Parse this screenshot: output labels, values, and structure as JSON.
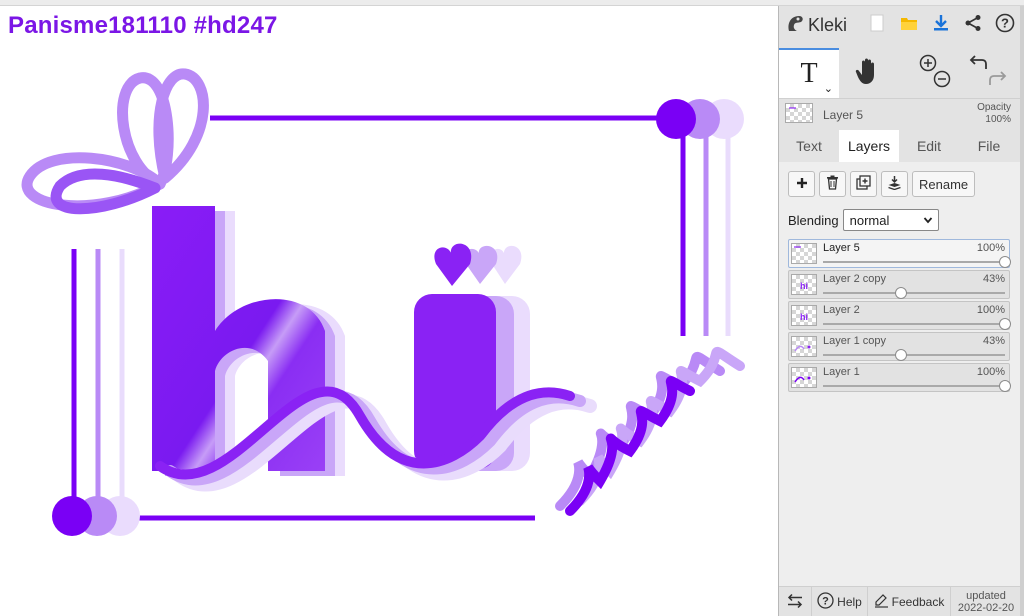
{
  "canvas": {
    "title": "Panisme181110 #hd247",
    "accent": "#7a00f5"
  },
  "header": {
    "app_name": "Kleki",
    "icons": [
      "kleki-logo-icon",
      "new-file-icon",
      "open-folder-icon",
      "download-icon",
      "share-icon",
      "help-icon"
    ]
  },
  "tools": {
    "items": [
      {
        "name": "text-tool",
        "label": "T",
        "active": true
      },
      {
        "name": "hand-tool",
        "active": false
      },
      {
        "name": "zoom-tool",
        "active": false
      },
      {
        "name": "undo-redo",
        "active": false
      }
    ]
  },
  "current_layer": {
    "name": "Layer 5",
    "opacity_label": "Opacity",
    "opacity_value": "100%"
  },
  "tabs": [
    {
      "label": "Text",
      "active": false
    },
    {
      "label": "Layers",
      "active": true
    },
    {
      "label": "Edit",
      "active": false
    },
    {
      "label": "File",
      "active": false
    }
  ],
  "layer_panel": {
    "rename_label": "Rename",
    "blending_label": "Blending",
    "blending_value": "normal",
    "layers": [
      {
        "name": "Layer 5",
        "opacity": "100%",
        "value": 1.0,
        "selected": true
      },
      {
        "name": "Layer 2 copy",
        "opacity": "43%",
        "value": 0.43,
        "selected": false
      },
      {
        "name": "Layer 2",
        "opacity": "100%",
        "value": 1.0,
        "selected": false
      },
      {
        "name": "Layer 1 copy",
        "opacity": "43%",
        "value": 0.43,
        "selected": false
      },
      {
        "name": "Layer 1",
        "opacity": "100%",
        "value": 1.0,
        "selected": false
      }
    ]
  },
  "footer": {
    "help_label": "Help",
    "feedback_label": "Feedback",
    "updated_label": "updated",
    "updated_date": "2022-02-20"
  }
}
